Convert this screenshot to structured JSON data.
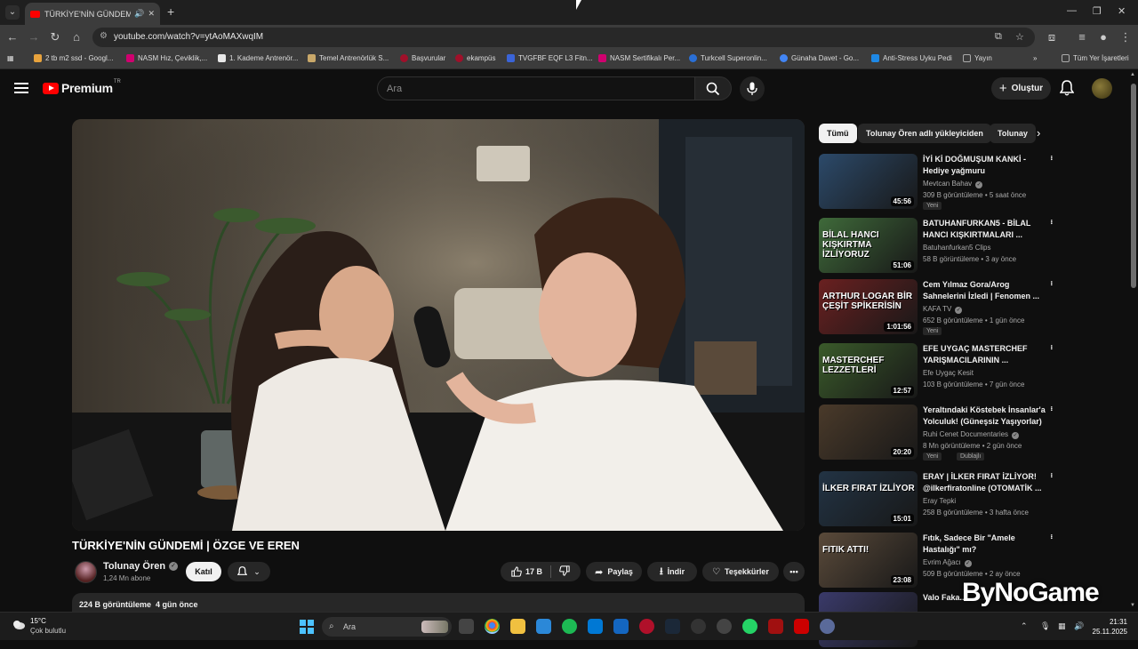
{
  "browser": {
    "tab_title": "TÜRKİYE'NİN GÜNDEMİ | Ö",
    "url": "youtube.com/watch?v=ytAoMAXwqIM",
    "bookmarks": [
      {
        "label": "2 tb m2 ssd - Googl...",
        "color": "#e8a33d"
      },
      {
        "label": "NASM Hız, Çeviklik,...",
        "color": "#d0006f"
      },
      {
        "label": "1. Kademe Antrenör...",
        "color": "#e8e8e8"
      },
      {
        "label": "Temel Antrenörlük S...",
        "color": "#c9a86a"
      },
      {
        "label": "Başvurular",
        "color": "#a0102a"
      },
      {
        "label": "ekampüs",
        "color": "#a0102a"
      },
      {
        "label": "TVGFBF EQF L3 Fitn...",
        "color": "#3a64d8"
      },
      {
        "label": "NASM Sertifikalı Per...",
        "color": "#d0006f"
      },
      {
        "label": "Turkcell Superonlin...",
        "color": "#2a6fd6"
      },
      {
        "label": "Günaha Davet - Go...",
        "color": "#4285f4"
      },
      {
        "label": "Anti-Stress Uyku Pedi",
        "color": "#1e88e5"
      },
      {
        "label": "Yayın",
        "color": "#888888"
      }
    ],
    "all_bookmarks": "Tüm Yer İşaretleri"
  },
  "header": {
    "logo_text": "Premium",
    "logo_country": "TR",
    "search_placeholder": "Ara",
    "create_label": "Oluştur"
  },
  "video": {
    "title": "TÜRKİYE'NİN GÜNDEMİ | ÖZGE VE EREN",
    "channel": "Tolunay Ören",
    "subscribers": "1,24 Mn abone",
    "join_label": "Katıl",
    "likes": "17 B",
    "share_label": "Paylaş",
    "download_label": "İndir",
    "thanks_label": "Teşekkürler",
    "views": "224 B görüntüleme",
    "age": "4 gün önce"
  },
  "chips": [
    "Tümü",
    "Tolunay Ören adlı yükleyiciden",
    "Tolunay"
  ],
  "recommendations": [
    {
      "title": "İYİ Kİ DOĞMUŞUM KANKİ - Hediye yağmuru",
      "channel": "Mevtcan Bahav",
      "verified": true,
      "views": "309 B görüntüleme",
      "age": "5 saat önce",
      "duration": "45:56",
      "badges": [
        "Yeni"
      ],
      "thumb_text": "",
      "thumb_color": "#2c4a6a"
    },
    {
      "title": "BATUHANFURKAN5 - BİLAL HANCI KIŞKIRTMALARI ...",
      "channel": "Batuhanfurkan5 Clips",
      "verified": false,
      "views": "58 B görüntüleme",
      "age": "3 ay önce",
      "duration": "51:06",
      "badges": [],
      "thumb_text": "BİLAL HANCI KIŞKIRTMA İZLİYORUZ",
      "thumb_color": "#3f6a3a"
    },
    {
      "title": "Cem Yılmaz Gora/Arog Sahnelerini İzledi | Fenomen ...",
      "channel": "KAFA TV",
      "verified": true,
      "views": "652 B görüntüleme",
      "age": "1 gün önce",
      "duration": "1:01:56",
      "badges": [
        "Yeni"
      ],
      "thumb_text": "ARTHUR LOGAR BİR ÇEŞİT SPİKERİSİN",
      "thumb_color": "#6a2020"
    },
    {
      "title": "EFE UYGAÇ MASTERCHEF YARIŞMACILARININ ...",
      "channel": "Efe Uygaç Kesit",
      "verified": false,
      "views": "103 B görüntüleme",
      "age": "7 gün önce",
      "duration": "12:57",
      "badges": [],
      "thumb_text": "MASTERCHEF LEZZETLERİ",
      "thumb_color": "#3a5a2a"
    },
    {
      "title": "Yeraltındaki Köstebek İnsanlar'a Yolculuk! (Güneşsiz Yaşıyorlar)",
      "channel": "Ruhi Cenet Documentaries",
      "verified": true,
      "views": "8 Mn görüntüleme",
      "age": "2 gün önce",
      "duration": "20:20",
      "badges": [
        "Yeni",
        "Dublajlı"
      ],
      "thumb_text": "",
      "thumb_color": "#4a3a2a"
    },
    {
      "title": "ERAY | İLKER FIRAT İZLİYOR! @ilkerfiratonline (OTOMATİK ...",
      "channel": "Eray Tepki",
      "verified": false,
      "views": "258 B görüntüleme",
      "age": "3 hafta önce",
      "duration": "15:01",
      "badges": [],
      "thumb_text": "İLKER FIRAT İZLİYOR",
      "thumb_color": "#223344"
    },
    {
      "title": "Fıtık, Sadece Bir \"Amele Hastalığı\" mı?",
      "channel": "Evrim Ağacı",
      "verified": true,
      "views": "509 B görüntüleme",
      "age": "2 ay önce",
      "duration": "23:08",
      "badges": [],
      "thumb_text": "FITIK ATTI!",
      "thumb_color": "#5a4a3a"
    },
    {
      "title": "Valo Faka...",
      "channel": "",
      "verified": false,
      "views": "",
      "age": "",
      "duration": "",
      "badges": [],
      "thumb_text": "",
      "thumb_color": "#3a3a6a"
    }
  ],
  "taskbar": {
    "temp": "15°C",
    "weather": "Çok bulutlu",
    "search_label": "Ara",
    "time": "21:31",
    "date": "25.11.2025"
  },
  "watermark": "ByNoGame"
}
